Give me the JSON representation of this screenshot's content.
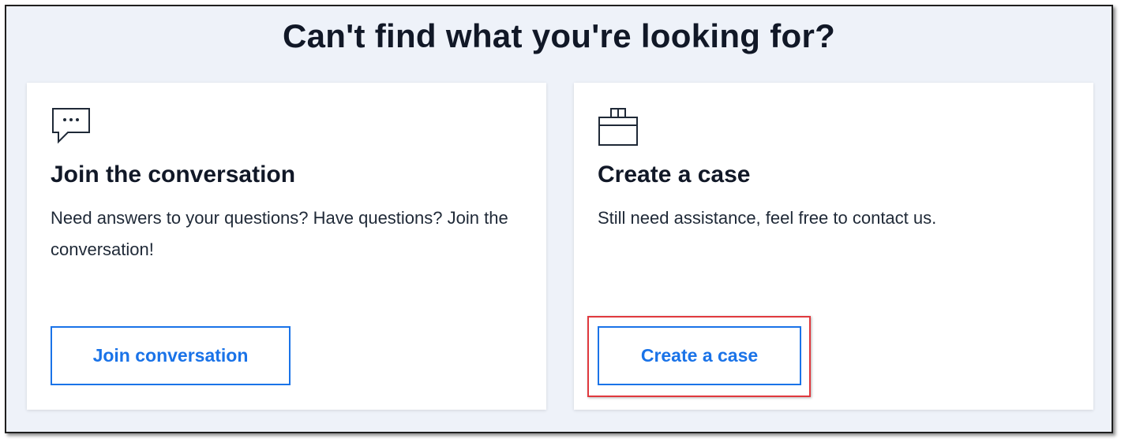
{
  "header": {
    "title": "Can't find what you're looking for?"
  },
  "cards": [
    {
      "icon": "chat-bubble-icon",
      "title": "Join the conversation",
      "description": "Need answers to your questions? Have questions? Join the conversation!",
      "button_label": "Join conversation"
    },
    {
      "icon": "briefcase-icon",
      "title": "Create a case",
      "description": "Still need assistance, feel free to contact us.",
      "button_label": "Create a case",
      "highlighted": true
    }
  ],
  "colors": {
    "background": "#eef2f9",
    "card": "#ffffff",
    "accent": "#1a73e8",
    "highlight": "#e0393e",
    "text": "#111827"
  }
}
